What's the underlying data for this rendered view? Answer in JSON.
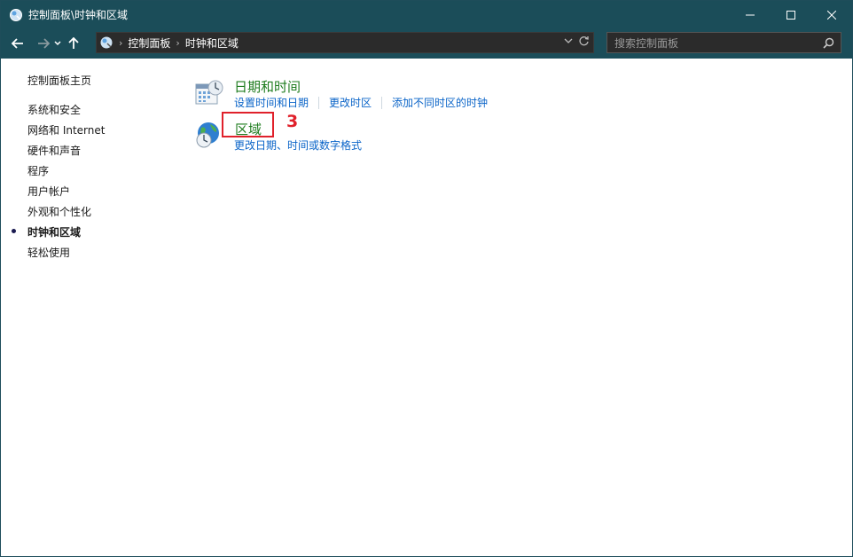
{
  "window": {
    "title": "控制面板\\时钟和区域"
  },
  "address": {
    "crumbs": [
      "控制面板",
      "时钟和区域"
    ]
  },
  "search": {
    "placeholder": "搜索控制面板"
  },
  "sidebar": {
    "home": "控制面板主页",
    "items": [
      {
        "label": "系统和安全",
        "active": false
      },
      {
        "label": "网络和 Internet",
        "active": false
      },
      {
        "label": "硬件和声音",
        "active": false
      },
      {
        "label": "程序",
        "active": false
      },
      {
        "label": "用户帐户",
        "active": false
      },
      {
        "label": "外观和个性化",
        "active": false
      },
      {
        "label": "时钟和区域",
        "active": true
      },
      {
        "label": "轻松使用",
        "active": false
      }
    ]
  },
  "categories": [
    {
      "title": "日期和时间",
      "icon": "calendar-clock-icon",
      "links": [
        "设置时间和日期",
        "更改时区",
        "添加不同时区的时钟"
      ]
    },
    {
      "title": "区域",
      "icon": "globe-clock-icon",
      "links": [
        "更改日期、时间或数字格式"
      ]
    }
  ],
  "annotation": {
    "step": "3",
    "color": "#e0212b"
  },
  "colors": {
    "titlebar": "#1b4d59",
    "link": "#0a64c8",
    "category_title": "#1e7c1e"
  }
}
